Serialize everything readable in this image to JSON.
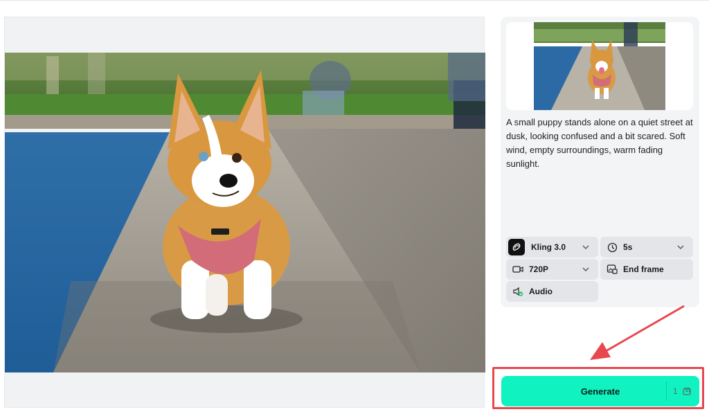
{
  "preview": {
    "image_alt": "Corgi puppy with pink harness standing on stone ledge beside a pond"
  },
  "side_panel": {
    "thumbnail_alt": "Corgi puppy running along path by water",
    "prompt": "A small puppy stands alone on a quiet street at dusk, looking confused and a bit scared. Soft wind, empty surroundings, warm fading sunlight.",
    "options": {
      "model": {
        "label": "Kling 3.0",
        "icon": "kling-logo-icon"
      },
      "duration": {
        "label": "5s",
        "icon": "clock-icon"
      },
      "resolution": {
        "label": "720P",
        "icon": "video-camera-icon"
      },
      "end_frame": {
        "label": "End frame",
        "icon": "image-frame-icon"
      },
      "audio": {
        "label": "Audio",
        "icon": "speaker-icon"
      }
    }
  },
  "generate": {
    "label": "Generate",
    "credits": "1",
    "credits_icon": "coin-stack-icon"
  },
  "colors": {
    "generate_bg": "#10f2c0",
    "highlight": "#e8474f",
    "option_bg": "#e4e5e8",
    "panel_bg": "#f3f4f6"
  }
}
